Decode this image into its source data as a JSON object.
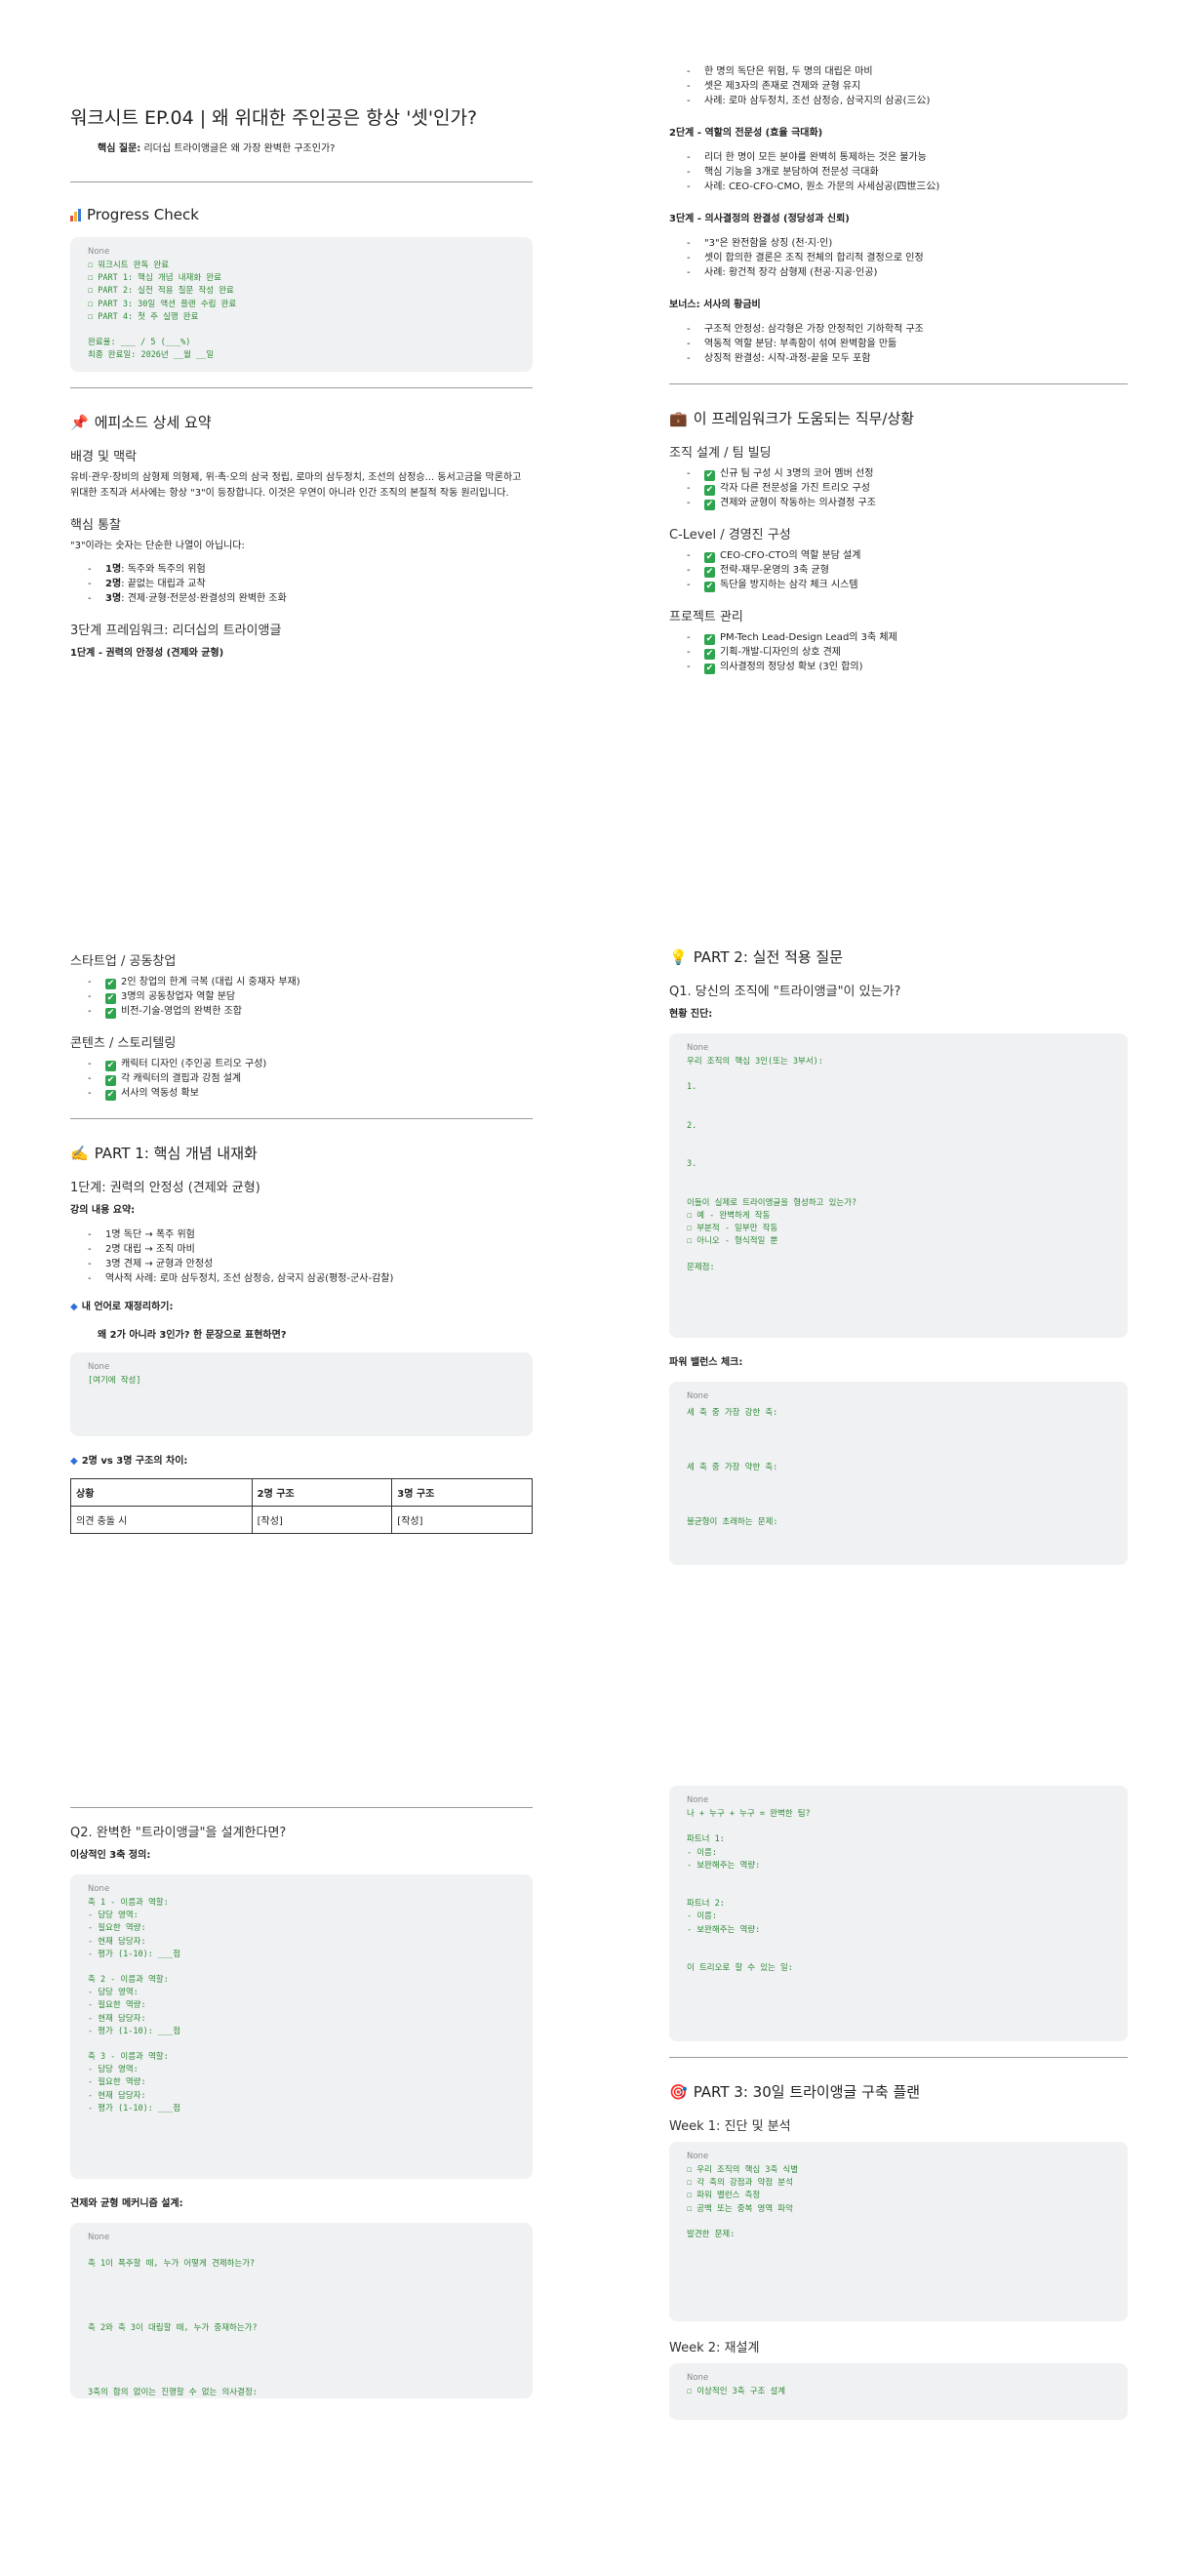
{
  "p1": {
    "title": "워크시트 EP.04 | 왜 위대한 주인공은 항상 '셋'인가?",
    "core_question_label": "핵심 질문:",
    "core_question": " 리더십 트라이앵글은 왜 가장 완벽한 구조인가?",
    "progress_heading": "Progress Check",
    "progress_code_lang": "None",
    "progress_code": "☐ 워크시트 완독 완료\n☐ PART 1: 핵심 개념 내재화 완료\n☐ PART 2: 실전 적용 질문 작성 완료\n☐ PART 3: 30일 액션 플랜 수립 완료\n☐ PART 4: 첫 주 실행 완료\n\n완료율: ___ / 5 (___%)\n최종 완료일: 2026년 __월 __일",
    "episode_heading": "에피소드 상세 요약",
    "background_heading": "배경 및 맥락",
    "background_text": "유비·관우·장비의 삼형제 의형제, 위·촉·오의 삼국 정립, 로마의 삼두정치, 조선의 삼정승... 동서고금을 막론하고 위대한 조직과 서사에는 항상 \"3\"이 등장합니다. 이것은 우연이 아니라 인간 조직의 본질적 작동 원리입니다.",
    "insight_heading": "핵심 통찰",
    "insight_lead": "\"3\"이라는 숫자는 단순한 나열이 아닙니다:",
    "insight_items": [
      {
        "b": "1명",
        "t": ": 독주와 독주의 위험"
      },
      {
        "b": "2명",
        "t": ": 끝없는 대립과 교착"
      },
      {
        "b": "3명",
        "t": ": 견제·균형·전문성·완결성의 완벽한 조화"
      }
    ],
    "framework_heading": "3단계 프레임워크: 리더십의 트라이앵글",
    "step1_heading": "1단계 - 권력의 안정성 (견제와 균형)"
  },
  "p2": {
    "step1_items": [
      "한 명의 독단은 위험, 두 명의 대립은 마비",
      "셋은 제3자의 존재로 견제와 균형 유지",
      "사례: 로마 삼두정치, 조선 삼정승, 삼국지의 삼공(三公)"
    ],
    "step2_heading": "2단계 - 역할의 전문성 (효율 극대화)",
    "step2_items": [
      "리더 한 명이 모든 분야를 완벽히 통제하는 것은 불가능",
      "핵심 기능을 3개로 분담하여 전문성 극대화",
      "사례: CEO-CFO-CMO, 원소 가문의 사세삼공(四世三公)"
    ],
    "step3_heading": "3단계 - 의사결정의 완결성 (정당성과 신뢰)",
    "step3_items": [
      "\"3\"은 완전함을 상징 (천·지·인)",
      "셋이 합의한 결론은 조직 전체의 합리적 결정으로 인정",
      "사례: 황건적 장각 삼형제 (천공·지공·인공)"
    ],
    "bonus_heading": "보너스: 서사의 황금비",
    "bonus_items": [
      "구조적 안정성: 삼각형은 가장 안정적인 기하학적 구조",
      "역동적 역할 분담: 부족함이 섞여 완벽함을 만듦",
      "상징적 완결성: 시작-과정-끝을 모두 포함"
    ],
    "jobs_heading": "이 프레임워크가 도움되는 직무/상황",
    "org_heading": "조직 설계 / 팀 빌딩",
    "org_items": [
      "신규 팀 구성 시 3명의 코어 멤버 선정",
      "각자 다른 전문성을 가진 트리오 구성",
      "견제와 균형이 작동하는 의사결정 구조"
    ],
    "clevel_heading": "C-Level / 경영진 구성",
    "clevel_items": [
      "CEO-CFO-CTO의 역할 분담 설계",
      "전략-재무-운영의 3축 균형",
      "독단을 방지하는 삼각 체크 시스템"
    ],
    "project_heading": "프로젝트 관리",
    "project_items": [
      "PM-Tech Lead-Design Lead의 3축 체제",
      "기획-개발-디자인의 상호 견제",
      "의사결정의 정당성 확보 (3인 합의)"
    ]
  },
  "p3": {
    "startup_heading": "스타트업 / 공동창업",
    "startup_items": [
      "2인 창업의 한계 극복 (대립 시 중재자 부재)",
      "3명의 공동창업자 역할 분담",
      "비전-기술-영업의 완벽한 조합"
    ],
    "content_heading": "콘텐츠 / 스토리텔링",
    "content_items": [
      "캐릭터 디자인 (주인공 트리오 구성)",
      "각 캐릭터의 결핍과 강점 설계",
      "서사의 역동성 확보"
    ],
    "part1_heading": "PART 1: 핵심 개념 내재화",
    "part1_step_heading": "1단계: 권력의 안정성 (견제와 균형)",
    "lecture_summary": "강의 내용 요약:",
    "lecture_items": [
      "1명 독단 → 폭주 위험",
      "2명 대립 → 조직 마비",
      "3명 견제 → 균형과 안정성",
      "역사적 사례: 로마 삼두정치, 조선 삼정승, 삼국지 삼공(평정-군사-감찰)"
    ],
    "restate_heading": "내 언어로 재정리하기:",
    "restate_question": "왜 2가 아니라 3인가? 한 문장으로 표현하면?",
    "restate_code_lang": "None",
    "restate_code": "[여기에 작성]",
    "compare_heading": "2명 vs 3명 구조의 차이:",
    "table_headers": [
      "상황",
      "2명 구조",
      "3명 구조"
    ],
    "table_rows": [
      [
        "의견 충돌 시",
        "[작성]",
        "[작성]"
      ]
    ]
  },
  "p4": {
    "part2_heading": "PART 2: 실전 적용 질문",
    "q1_heading": "Q1. 당신의 조직에 \"트라이앵글\"이 있는가?",
    "diagnosis_label": "현황 진단:",
    "diagnosis_code_lang": "None",
    "diagnosis_code": "우리 조직의 핵심 3인(또는 3부서):\n\n1.\n\n\n2.\n\n\n3.\n\n\n이들이 실제로 트라이앵글을 형성하고 있는가?\n☐ 예 - 완벽하게 작동\n☐ 부분적 - 일부만 작동\n☐ 아니오 - 형식적일 뿐\n\n문제점:\n\n\n\n",
    "power_label": "파워 밸런스 체크:",
    "power_code_lang": "None",
    "power_code": "세 축 중 가장 강한 축:\n\n\n세 축 중 가장 약한 축:\n\n\n불균형이 초래하는 문제:\n\n\n"
  },
  "p5": {
    "q2_heading": "Q2. 완벽한 \"트라이앵글\"을 설계한다면?",
    "ideal_label": "이상적인 3축 정의:",
    "ideal_code_lang": "None",
    "ideal_code": "축 1 - 이름과 역할:\n- 담당 영역:\n- 필요한 역량:\n- 현재 담당자:\n- 평가 (1-10): ___점\n\n축 2 - 이름과 역할:\n- 담당 영역:\n- 필요한 역량:\n- 현재 담당자:\n- 평가 (1-10): ___점\n\n축 3 - 이름과 역할:\n- 담당 영역:\n- 필요한 역량:\n- 현재 담당자:\n- 평가 (1-10): ___점\n",
    "mechanism_label": "견제와 균형 메커니즘 설계:",
    "mechanism_code_lang": "None",
    "mechanism_code": "\n축 1이 폭주할 때, 누가 어떻게 견제하는가?\n\n\n\n\n축 2와 축 3이 대립할 때, 누가 중재하는가?\n\n\n\n\n3축의 합의 없이는 진행할 수 없는 의사결정:\n"
  },
  "p6": {
    "partner_code_lang": "None",
    "partner_code": "나 + 누구 + 누구 = 완벽한 팀?\n\n파트너 1:\n- 이름:\n- 보완해주는 역량:\n\n\n파트너 2:\n- 이름:\n- 보완해주는 역량:\n\n\n이 트리오로 할 수 있는 일:\n\n\n\n\n",
    "part3_heading": "PART 3: 30일 트라이앵글 구축 플랜",
    "week1_heading": "Week 1: 진단 및 분석",
    "week1_code_lang": "None",
    "week1_code": "☐ 우리 조직의 핵심 3축 식별\n☐ 각 축의 강점과 약점 분석\n☐ 파워 밸런스 측정\n☐ 공백 또는 중복 영역 파악\n\n발견한 문제:\n\n\n\n",
    "week2_heading": "Week 2: 재설계",
    "week2_code_lang": "None",
    "week2_code": "☐ 이상적인 3축 구조 설계"
  }
}
